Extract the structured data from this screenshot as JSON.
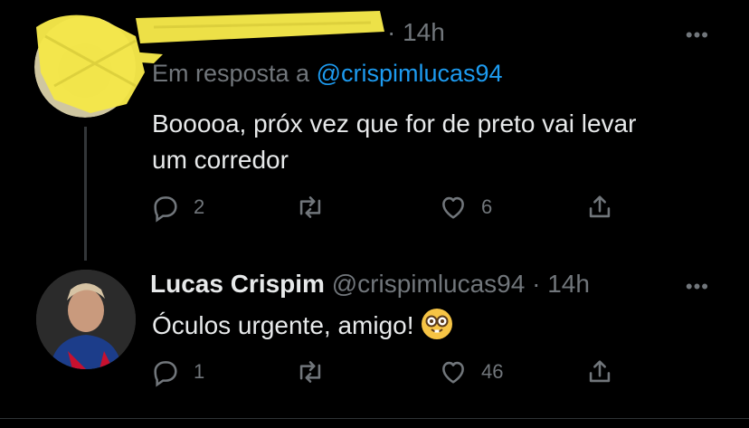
{
  "tweet1": {
    "time": "· 14h",
    "more": "•••",
    "reply_prefix": "Em resposta a",
    "reply_mention": "@crispimlucas94",
    "text_line1": "Booooa, próx vez que for de preto vai levar",
    "text_line2": "um corredor",
    "replies": "2",
    "retweets": "",
    "likes": "6"
  },
  "tweet2": {
    "name": "Lucas Crispim",
    "handle": "@crispimlucas94",
    "time": "· 14h",
    "more": "•••",
    "text": "Óculos urgente, amigo!",
    "emoji_icon": "nerd-face-emoji",
    "replies": "1",
    "retweets": "",
    "likes": "46"
  },
  "colors": {
    "background": "#000000",
    "text": "#e7e9ea",
    "muted": "#71767b",
    "link": "#1d9bf0",
    "redaction": "#f5e84a"
  }
}
